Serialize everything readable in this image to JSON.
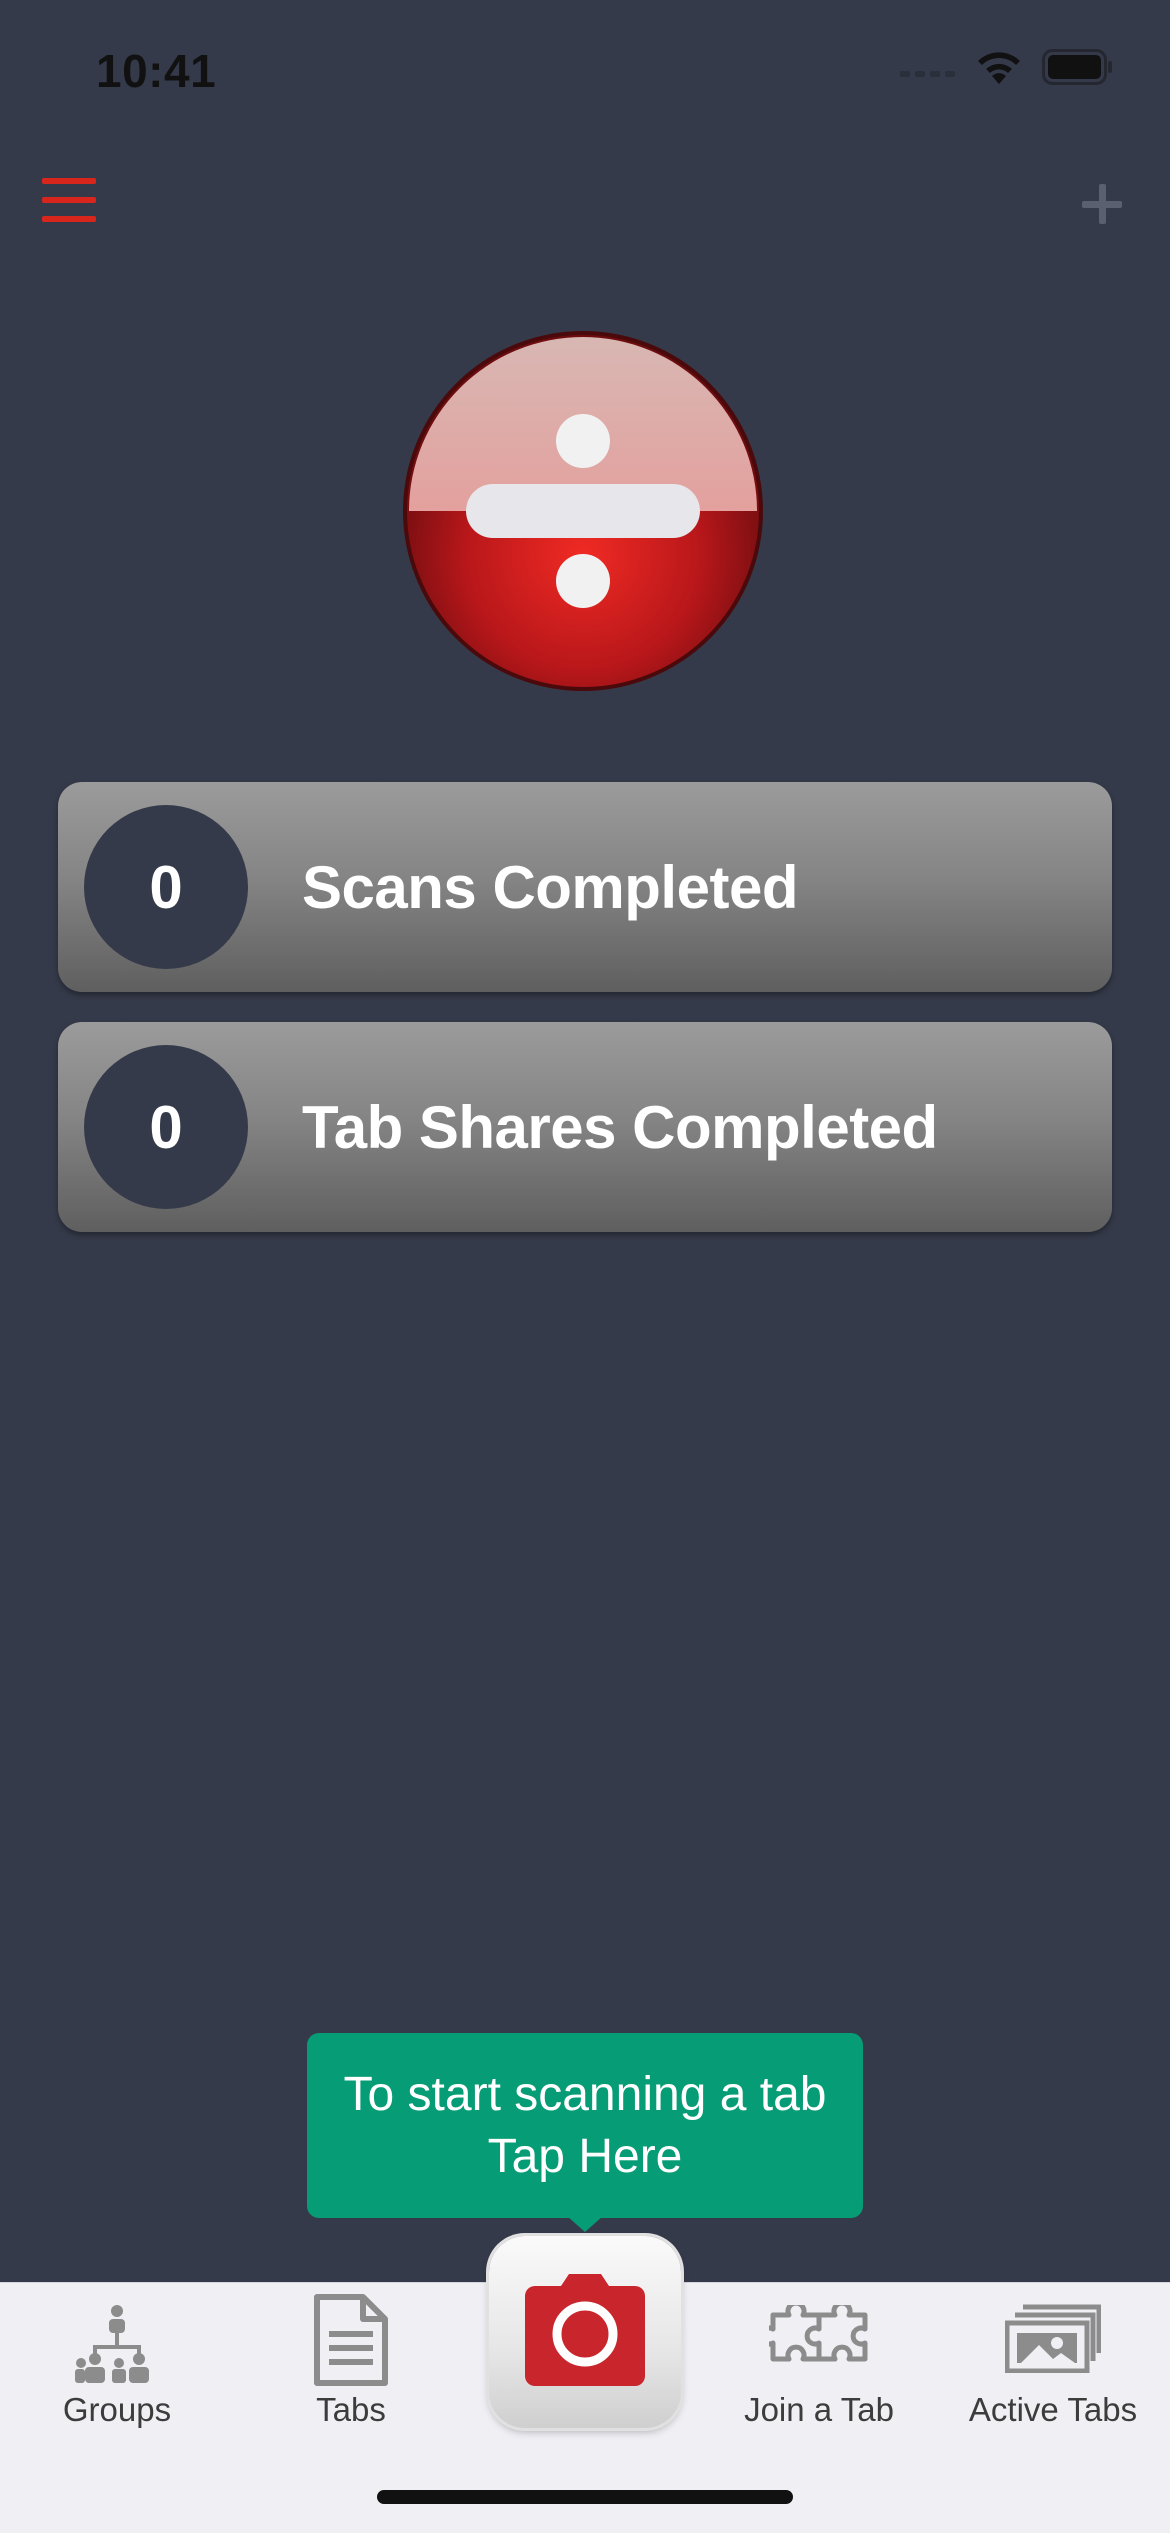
{
  "status_bar": {
    "time": "10:41"
  },
  "header": {
    "menu_icon": "hamburger-menu-icon",
    "add_icon": "plus-icon"
  },
  "logo": {
    "icon": "divide-logo-icon"
  },
  "stats": [
    {
      "count": "0",
      "label": "Scans Completed"
    },
    {
      "count": "0",
      "label": "Tab Shares Completed"
    }
  ],
  "tooltip": {
    "line1": "To start scanning a tab",
    "line2": "Tap Here"
  },
  "tab_bar": {
    "items": [
      {
        "label": "Groups",
        "icon": "groups-icon"
      },
      {
        "label": "Tabs",
        "icon": "document-icon"
      },
      {
        "label": "",
        "icon": "camera-icon"
      },
      {
        "label": "Join a Tab",
        "icon": "puzzle-icon"
      },
      {
        "label": "Active Tabs",
        "icon": "photos-stack-icon"
      }
    ]
  },
  "colors": {
    "background": "#353a4a",
    "accent_red": "#d9261c",
    "tooltip_green": "#069c75",
    "tab_bar": "#efeff4"
  }
}
